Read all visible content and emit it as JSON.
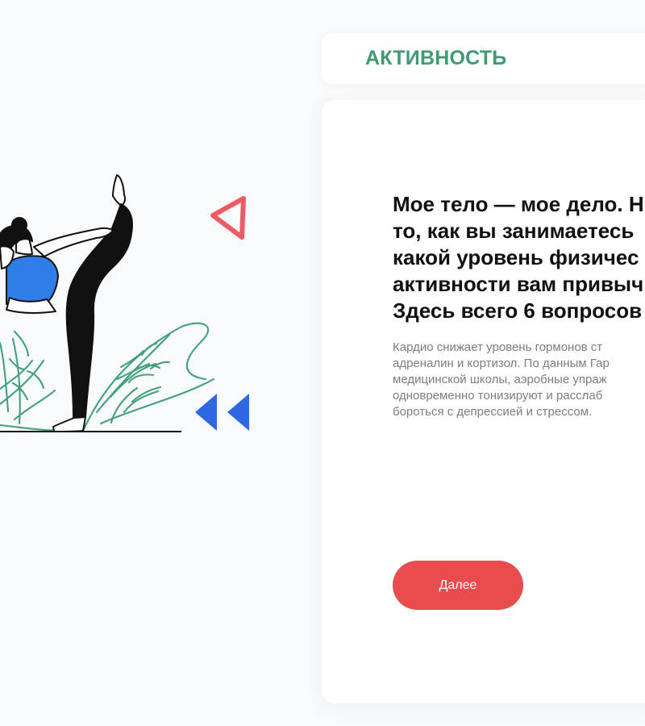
{
  "header": {
    "title": "АКТИВНОСТЬ"
  },
  "question": {
    "title": "Мое тело — мое дело. Н\nто, как вы занимаетесь\nкакой уровень физичес\nактивности вам привыч\nЗдесь всего 6 вопросов",
    "note": "Кардио снижает уровень гормонов ст\nадреналин и кортизол. По данным Гар\nмедицинской школы, аэробные упраж\nодновременно тонизируют и расслаб\nбороться с депрессией и стрессом."
  },
  "actions": {
    "next_label": "Далее"
  },
  "illustration": {
    "subject": "yoga-dancer-pose",
    "colors": {
      "body": "#111111",
      "top": "#2f7ee8",
      "leaves": "#43a07e",
      "triangle_outline": "#ef5b64",
      "triangles_filled": "#2f68e3",
      "skin": "#ffffff"
    }
  },
  "colors": {
    "page_background": "#f9fafc",
    "card_background": "#ffffff",
    "accent_green": "#3f9a72",
    "accent_red": "#e84c4c",
    "text_dark": "#111111",
    "text_muted": "#7d7d7d"
  }
}
